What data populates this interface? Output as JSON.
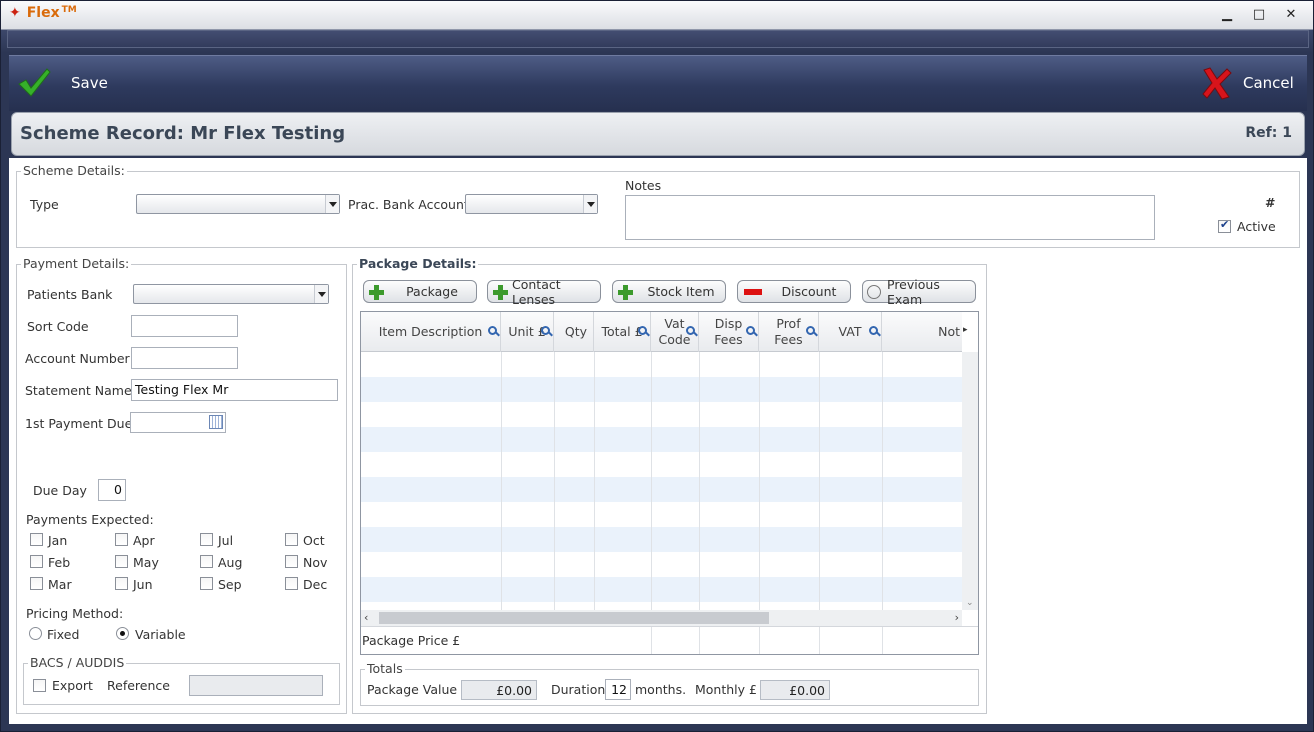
{
  "app": {
    "name": "Flex",
    "tm": "TM"
  },
  "toolbar": {
    "save_label": "Save",
    "cancel_label": "Cancel"
  },
  "record": {
    "title": "Scheme Record: Mr Flex Testing",
    "ref": "Ref: 1"
  },
  "scheme_details": {
    "group_label": "Scheme Details:",
    "type_label": "Type",
    "type_value": "",
    "bank_label": "Prac. Bank Account",
    "bank_value": "",
    "notes_label": "Notes",
    "notes_value": "",
    "hash": "#",
    "active_label": "Active",
    "active_checked": true
  },
  "payment_details": {
    "group_label": "Payment Details:",
    "patients_bank_label": "Patients Bank",
    "patients_bank_value": "",
    "sort_code_label": "Sort Code",
    "sort_code_value": "",
    "account_number_label": "Account Number",
    "account_number_value": "",
    "statement_name_label": "Statement Name",
    "statement_name_value": "Testing Flex Mr",
    "first_payment_label": "1st Payment Due",
    "first_payment_value": "",
    "due_day_label": "Due Day",
    "due_day_value": "0",
    "payments_expected_label": "Payments Expected:",
    "months": [
      "Jan",
      "Apr",
      "Jul",
      "Oct",
      "Feb",
      "May",
      "Aug",
      "Nov",
      "Mar",
      "Jun",
      "Sep",
      "Dec"
    ],
    "pricing_label": "Pricing Method:",
    "pricing_fixed": "Fixed",
    "pricing_variable": "Variable",
    "pricing_selected": "Variable",
    "bacs_label": "BACS / AUDDIS",
    "export_label": "Export",
    "reference_label": "Reference",
    "reference_value": ""
  },
  "package_details": {
    "group_label": "Package Details:",
    "buttons": {
      "package": "Package",
      "contact_lenses": "Contact Lenses",
      "stock_item": "Stock Item",
      "discount": "Discount",
      "previous_exam": "Previous Exam"
    },
    "columns": [
      "Item Description",
      "Unit £",
      "Qty",
      "Total £",
      "Vat Code",
      "Disp Fees",
      "Prof Fees",
      "VAT",
      "Not"
    ],
    "package_price_label": "Package Price £"
  },
  "totals": {
    "group_label": "Totals",
    "package_value_label": "Package Value",
    "package_value": "£0.00",
    "duration_label": "Duration",
    "duration_value": "12",
    "months_label": "months.",
    "monthly_label": "Monthly £",
    "monthly_value": "£0.00"
  },
  "colors": {
    "accent": "#d96a0a",
    "banner": "#2e3a5e",
    "row_alt": "#eaf2fb"
  }
}
